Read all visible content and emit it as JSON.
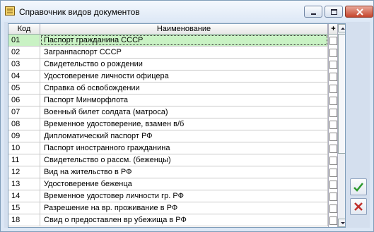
{
  "window": {
    "title": "Справочник видов документов"
  },
  "table": {
    "columns": {
      "code": "Код",
      "name": "Наименование",
      "flag": "+"
    },
    "rows": [
      {
        "code": "01",
        "name": "Паспорт гражданина СССР",
        "selected": true
      },
      {
        "code": "02",
        "name": "Загранпаспорт СССР"
      },
      {
        "code": "03",
        "name": "Свидетельство о рождении"
      },
      {
        "code": "04",
        "name": "Удостоверение личности офицера"
      },
      {
        "code": "05",
        "name": "Справка об освобождении"
      },
      {
        "code": "06",
        "name": "Паспорт Минморфлота"
      },
      {
        "code": "07",
        "name": "Военный билет солдата (матроса)"
      },
      {
        "code": "08",
        "name": "Временное удостоверение, взамен в/б"
      },
      {
        "code": "09",
        "name": "Дипломатический паспорт РФ"
      },
      {
        "code": "10",
        "name": "Паспорт иностранного гражданина"
      },
      {
        "code": "11",
        "name": "Свидетельство  о рассм. (беженцы)"
      },
      {
        "code": "12",
        "name": "Вид на жительство в РФ"
      },
      {
        "code": "13",
        "name": "Удостоверение беженца"
      },
      {
        "code": "14",
        "name": "Временное удостовер личности гр. РФ"
      },
      {
        "code": "15",
        "name": "Разрешение на вр. проживание в РФ"
      },
      {
        "code": "18",
        "name": "Свид о предоставлен вр убежища в РФ"
      }
    ]
  },
  "icons": {
    "title": "book-icon",
    "ok": "checkmark-icon",
    "cancel": "x-icon",
    "minimize": "minimize-icon",
    "maximize": "maximize-icon",
    "close": "close-icon"
  },
  "colors": {
    "selected_row": "#c9f2c4",
    "ok": "#2e9a2e",
    "cancel": "#c0302a"
  }
}
